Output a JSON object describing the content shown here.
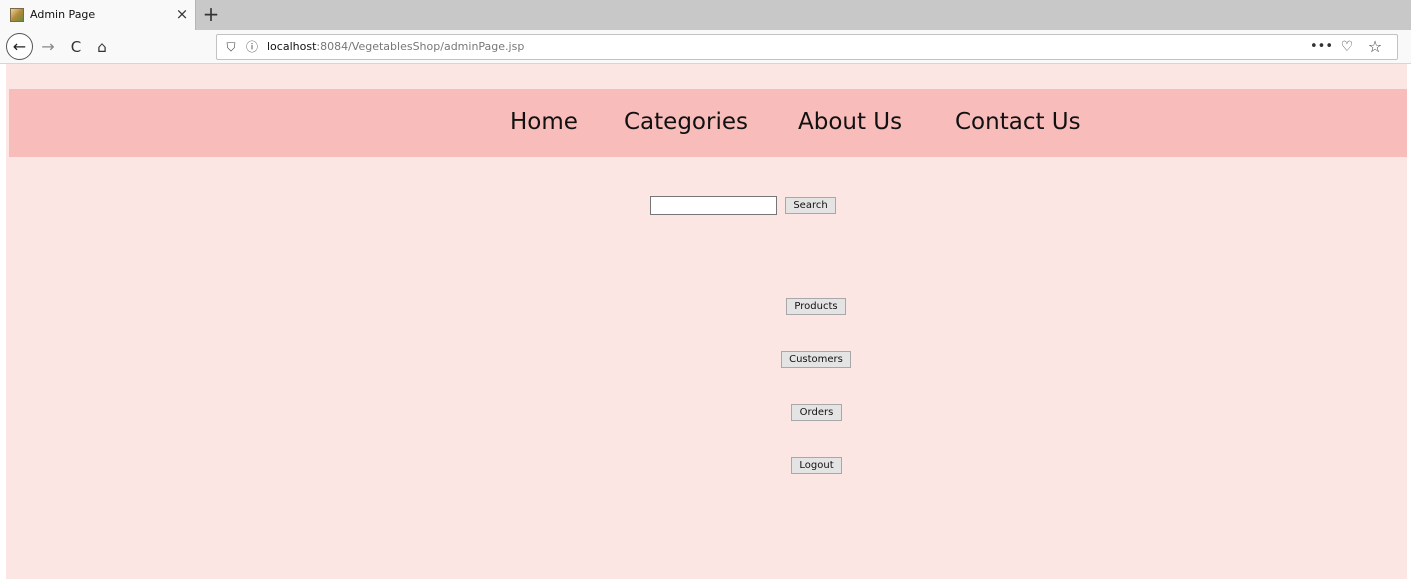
{
  "browser": {
    "tab": {
      "title": "Admin Page",
      "close_glyph": "×",
      "favicon": "page-favicon-icon"
    },
    "new_tab_glyph": "+",
    "nav": {
      "back_glyph": "←",
      "forward_glyph": "→",
      "reload_glyph": "C",
      "home_glyph": "⌂"
    },
    "url": {
      "host": "localhost",
      "rest": ":8084/VegetablesShop/adminPage.jsp",
      "shield_glyph": "⛉",
      "info_glyph": "ⓘ",
      "more_glyph": "•••",
      "pocket_glyph": "♡",
      "star_glyph": "☆"
    }
  },
  "site_nav": {
    "items": [
      {
        "label": "Home"
      },
      {
        "label": "Categories"
      },
      {
        "label": "About Us"
      },
      {
        "label": "Contact Us"
      }
    ]
  },
  "search": {
    "value": "",
    "placeholder": "",
    "button_label": "Search"
  },
  "admin_actions": {
    "products_label": "Products",
    "customers_label": "Customers",
    "orders_label": "Orders",
    "logout_label": "Logout"
  },
  "colors": {
    "page_background": "#fce6e4",
    "nav_background": "#f8bdbb"
  }
}
